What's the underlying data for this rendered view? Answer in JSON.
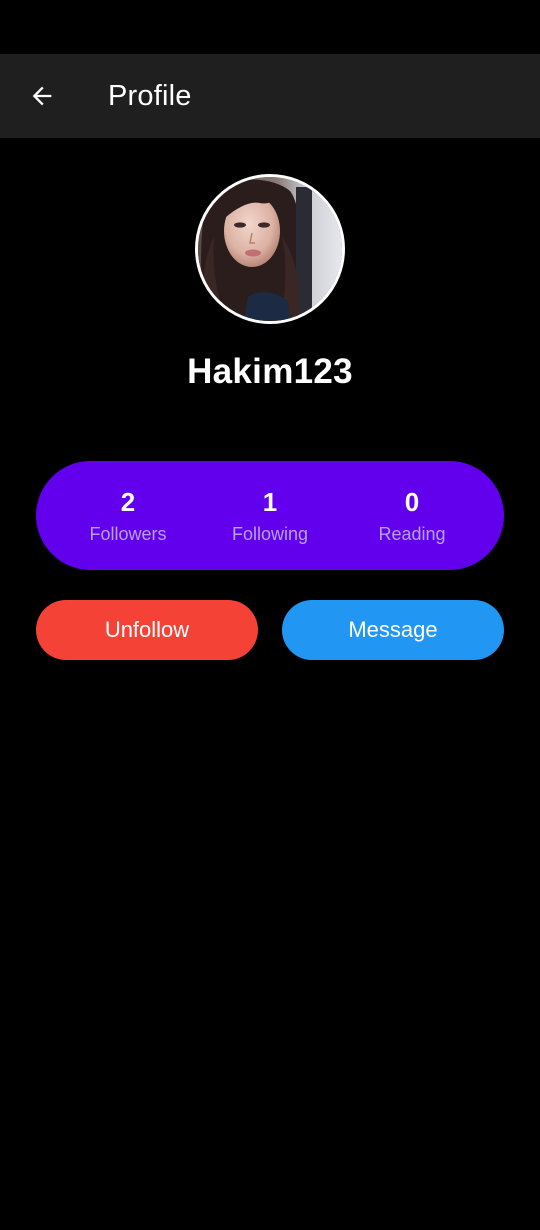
{
  "app_bar": {
    "title": "Profile",
    "back_icon": "arrow-left-icon",
    "background": "#1f1f1f"
  },
  "profile": {
    "username": "Hakim123",
    "avatar_icon": "profile-photo"
  },
  "stats": {
    "background": "#6200ee",
    "items": [
      {
        "value": "2",
        "label": "Followers"
      },
      {
        "value": "1",
        "label": "Following"
      },
      {
        "value": "0",
        "label": "Reading"
      }
    ]
  },
  "actions": {
    "unfollow": {
      "label": "Unfollow",
      "color": "#f44336"
    },
    "message": {
      "label": "Message",
      "color": "#2196f3"
    }
  }
}
